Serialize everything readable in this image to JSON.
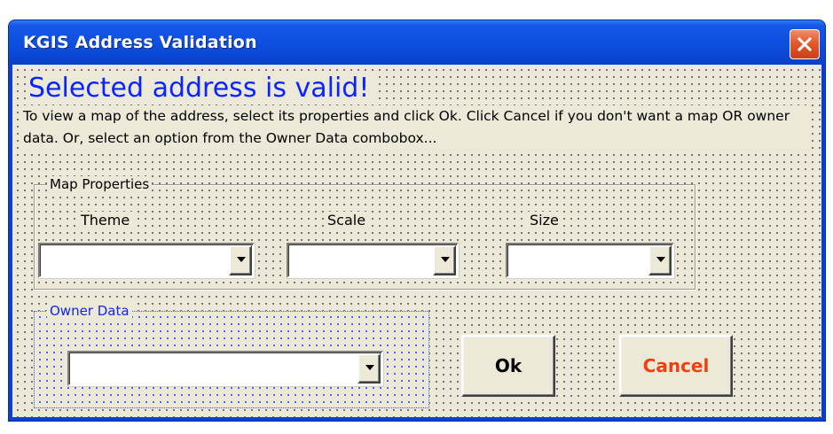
{
  "window": {
    "title": "KGIS Address Validation"
  },
  "message": {
    "headline": "Selected address is valid!",
    "instructions": "To view a map of the address, select its properties and click Ok.  Click Cancel if you don't want a map OR owner data.  Or, select an option from the Owner Data combobox..."
  },
  "map_properties": {
    "legend": "Map Properties",
    "theme": {
      "label": "Theme",
      "value": ""
    },
    "scale": {
      "label": "Scale",
      "value": ""
    },
    "size": {
      "label": "Size",
      "value": ""
    }
  },
  "owner_data": {
    "legend": "Owner Data",
    "value": ""
  },
  "buttons": {
    "ok": "Ok",
    "cancel": "Cancel"
  },
  "colors": {
    "titlebar": "#0a46d4",
    "headline": "#0a24ff",
    "owner_legend": "#1028e0",
    "cancel_text": "#f04010",
    "dialog_background": "#ece9d8"
  }
}
